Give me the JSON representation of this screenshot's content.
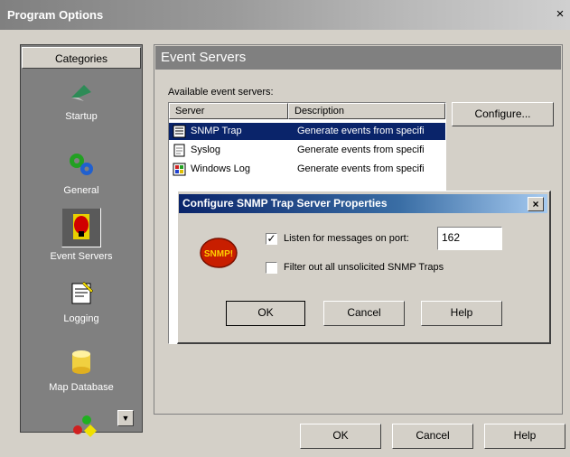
{
  "window": {
    "title": "Program Options",
    "close_glyph": "×"
  },
  "categories": {
    "header": "Categories",
    "items": [
      {
        "label": "Startup",
        "icon": "startup-flag-icon"
      },
      {
        "label": "General",
        "icon": "general-gears-icon"
      },
      {
        "label": "Event Servers",
        "icon": "event-servers-icon",
        "selected": true
      },
      {
        "label": "Logging",
        "icon": "logging-notepad-icon"
      },
      {
        "label": "Map Database",
        "icon": "map-database-icon"
      }
    ]
  },
  "event_servers": {
    "header": "Event Servers",
    "available_label": "Available event servers:",
    "columns": [
      "Server",
      "Description"
    ],
    "rows": [
      {
        "server": "SNMP Trap",
        "description": "Generate events from specifi",
        "icon": "snmp-trap-icon",
        "selected": true
      },
      {
        "server": "Syslog",
        "description": "Generate events from specifi",
        "icon": "syslog-document-icon"
      },
      {
        "server": "Windows Log",
        "description": "Generate events from specifi",
        "icon": "windows-log-icon"
      }
    ],
    "configure_label": "Configure..."
  },
  "dialog": {
    "title": "Configure SNMP Trap Server Properties",
    "close_glyph": "×",
    "badge_text": "SNMP!",
    "listen_label": "Listen for messages on port:",
    "listen_checked": true,
    "port_value": "162",
    "filter_label": "Filter out all unsolicited SNMP Traps",
    "filter_checked": false,
    "ok_label": "OK",
    "cancel_label": "Cancel",
    "help_label": "Help"
  },
  "footer": {
    "ok_label": "OK",
    "cancel_label": "Cancel",
    "help_label": "Help"
  },
  "colors": {
    "selection": "#0a246a",
    "panel_dark": "#808080",
    "face": "#d4d0c8"
  }
}
